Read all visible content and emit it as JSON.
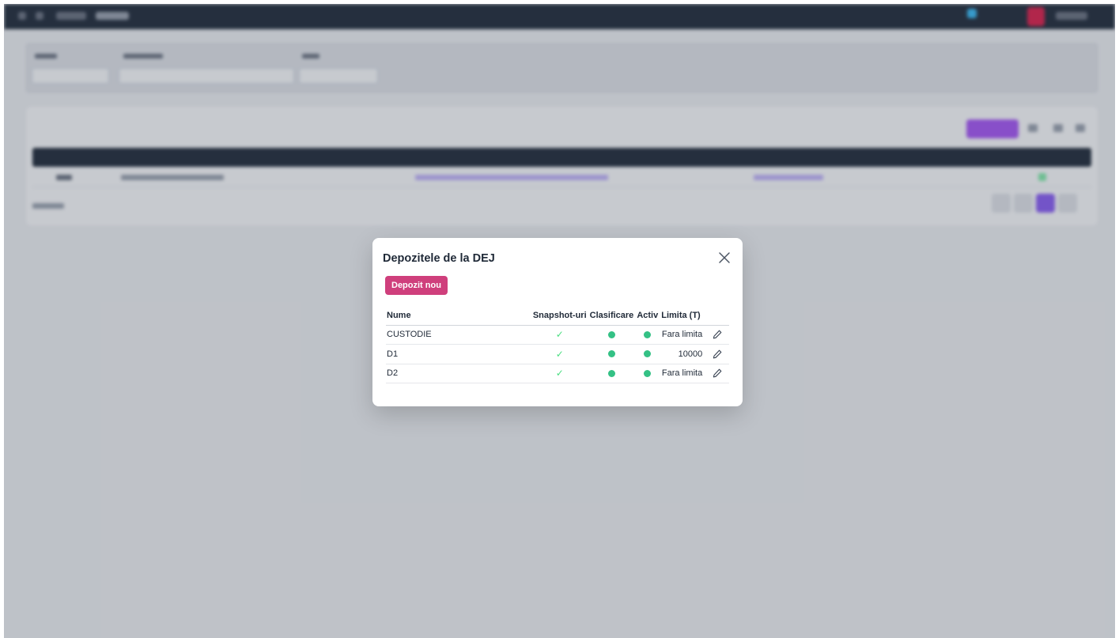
{
  "modal": {
    "title": "Depozitele de la DEJ",
    "new_button": "Depozit nou",
    "columns": {
      "name": "Nume",
      "snapshots": "Snapshot-uri",
      "classification": "Clasificare",
      "active": "Activ",
      "limit": "Limita (T)"
    },
    "rows": [
      {
        "name": "CUSTODIE",
        "snapshots": "✓",
        "classification": true,
        "active": true,
        "limit": "Fara limita"
      },
      {
        "name": "D1",
        "snapshots": "✓",
        "classification": true,
        "active": true,
        "limit": "10000"
      },
      {
        "name": "D2",
        "snapshots": "✓",
        "classification": true,
        "active": true,
        "limit": "Fara limita"
      }
    ]
  },
  "colors": {
    "primary_button": "#cf3f7c",
    "status_dot": "#34c185",
    "check": "#4ade80",
    "accent_background": "#8b5cf6"
  },
  "icons": {
    "close": "close-icon",
    "edit": "pencil-icon",
    "check": "check-icon",
    "status": "status-dot"
  }
}
